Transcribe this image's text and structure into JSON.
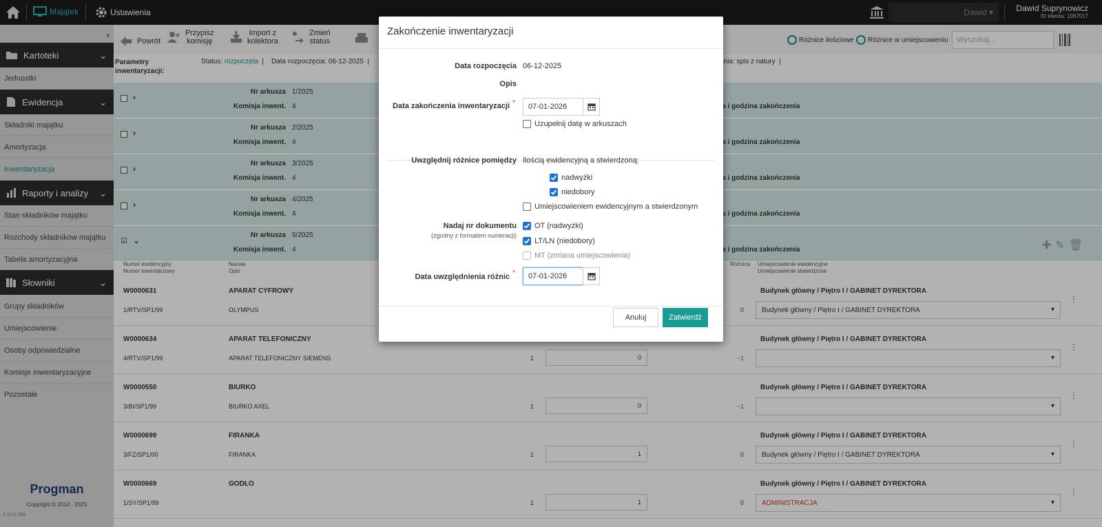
{
  "topbar": {
    "nav_majatek": "Majątek",
    "nav_ustawienia": "Ustawienia",
    "client_select": "Dawid",
    "user_name": "Dawid Suprynowicz",
    "client_id": "ID klienta: 1087017"
  },
  "sidebar": {
    "sections": [
      {
        "label": "Kartoteki"
      },
      {
        "label": "Ewidencja"
      },
      {
        "label": "Raporty i analizy"
      },
      {
        "label": "Słowniki"
      }
    ],
    "items": {
      "jednostki": "Jednostki",
      "skladniki": "Składniki majątku",
      "amortyzacja": "Amortyzacja",
      "inwentaryzacja": "Inwentaryzacja",
      "stan": "Stan składników majątku",
      "rozchody": "Rozchody składników majątku",
      "tabela": "Tabela amortyzacyjna",
      "grupy": "Grupy składników",
      "umiejscowienie": "Umiejscowienie",
      "osoby": "Osoby odpowiedzialne",
      "komisje": "Komisje inwentaryzacyjne",
      "pozostale": "Pozostałe"
    },
    "brand": "Progman",
    "copyright": "Copyright © 2014 - 2025",
    "version": "1.10.1.289"
  },
  "toolbar": {
    "powrot": "Powrót",
    "przypisz_1": "Przypisz",
    "przypisz_2": "komisję",
    "import_1": "Import z",
    "import_2": "kolektora",
    "zmien_1": "Zmień",
    "zmien_2": "status",
    "filter_ilosc": "Różnice ilościowe",
    "filter_umiejsc": "Różnice w umiejscowieniu",
    "search_placeholder": "Wyszukaj..."
  },
  "params": {
    "label_1": "Parametry",
    "label_2": "inwentaryzacji:",
    "status_label": "Status:",
    "status_value": "rozpoczęta",
    "date_start": "Data rozpoczęcia: 06-12-2025",
    "sposob": "zenia: spis z natury"
  },
  "sheets": {
    "nr_label": "Nr arkusza",
    "komisja_label": "Komisja inwent.",
    "data_end_label": "Data i godzina zakończenia",
    "list": [
      {
        "nr": "1/2025",
        "komisja": "4"
      },
      {
        "nr": "2/2025",
        "komisja": "4"
      },
      {
        "nr": "3/2025",
        "komisja": "4"
      },
      {
        "nr": "4/2025",
        "komisja": "4"
      },
      {
        "nr": "5/2025",
        "komisja": "4"
      }
    ]
  },
  "columns": {
    "ev_1": "Numer ewidencyjny",
    "ev_2": "Numer inwentarzowy",
    "nazwa": "Nazwa",
    "opis": "Opis",
    "roznica": "Różnica",
    "umiejsc_1": "Umiejscowienie ewidencyjne",
    "umiejsc_2": "Umiejscowienie stwierdzone"
  },
  "rows": [
    {
      "ev": "W0000631",
      "inv": "1/RTV/SP1/99",
      "name": "APARAT CYFROWY",
      "desc": "OLYMPUS",
      "qe": "",
      "qs": "",
      "diff": "0",
      "loc": "Budynek główny / Piętro I / GABINET DYREKTORA",
      "locsel": "Budynek główny / Piętro I / GABINET DYREKTORA"
    },
    {
      "ev": "W0000634",
      "inv": "4/RTV/SP1/99",
      "name": "APARAT TELEFONICZNY",
      "desc": "APARAT TELEFONICZNY SIEMENS",
      "qe": "1",
      "qs": "0",
      "diff": "−1",
      "loc": "Budynek główny / Piętro I / GABINET DYREKTORA",
      "locsel": ""
    },
    {
      "ev": "W0000550",
      "inv": "3/BI/SP1/99",
      "name": "BIURKO",
      "desc": "BIURKO AXEL",
      "qe": "1",
      "qs": "0",
      "diff": "−1",
      "loc": "Budynek główny / Piętro I / GABINET DYREKTORA",
      "locsel": ""
    },
    {
      "ev": "W0000699",
      "inv": "3/FZ/SP1/00",
      "name": "FIRANKA",
      "desc": "FIRANKA",
      "qe": "1",
      "qs": "1",
      "diff": "0",
      "loc": "Budynek główny / Piętro I / GABINET DYREKTORA",
      "locsel": "Budynek główny / Piętro I / GABINET DYREKTORA"
    },
    {
      "ev": "W0000669",
      "inv": "1/SY/SP1/99",
      "name": "GODŁO",
      "desc": "",
      "qe": "1",
      "qs": "1",
      "diff": "0",
      "loc": "Budynek główny / Piętro I / GABINET DYREKTORA",
      "locsel": "ADMINISTRACJA"
    }
  ],
  "modal": {
    "title": "Zakończenie inwentaryzacji",
    "date_start_label": "Data rozpoczęcia",
    "date_start_value": "06-12-2025",
    "opis_label": "Opis",
    "date_end_label": "Data zakończenia inwentaryzacji",
    "date_end_value": "07-01-2026",
    "fill_sheets": "Uzupełnij datę w arkuszach",
    "uwzglednij_label": "Uwzględnij różnice pomiędzy",
    "ilosc_label": "Ilością ewidencyjną a stwierdzoną:",
    "nadwyzki": "nadwyżki",
    "niedobory": "niedobory",
    "umiejsc_label": "Umiejscowieniem ewidencyjnym a stwierdzonym",
    "nadaj_label": "Nadaj nr dokumentu",
    "nadaj_note": "(zgodny z formatem numeracji)",
    "ot": "OT (nadwyżki)",
    "ltln": "LT/LN (niedobory)",
    "mt": "MT (zmiana umiejscowienia)",
    "date_diff_label": "Data uwzględnienia różnic",
    "date_diff_value": "07-01-2026",
    "cancel": "Anuluj",
    "confirm": "Zatwierdź"
  }
}
